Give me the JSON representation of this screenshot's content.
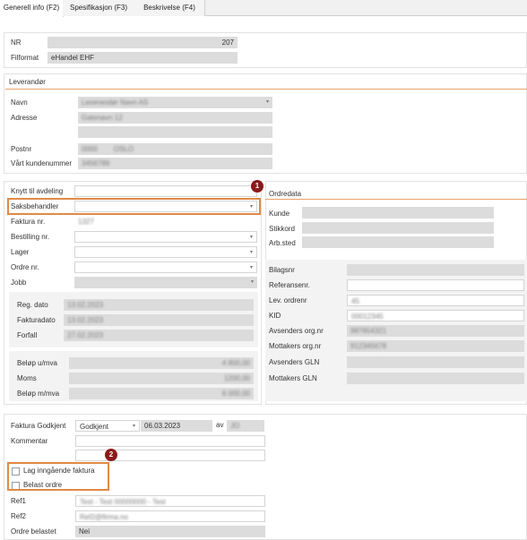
{
  "tabs": [
    {
      "label": "Generell info (F2)"
    },
    {
      "label": "Spesifikasjon (F3)"
    },
    {
      "label": "Beskrivelse (F4)"
    }
  ],
  "general": {
    "nr_label": "NR",
    "nr_value": "207",
    "filformat_label": "Filformat",
    "filformat_value": "eHandel EHF"
  },
  "leverandor": {
    "header": "Leverandør",
    "navn_label": "Navn",
    "navn_value": "Leverandør Navn AS",
    "adresse_label": "Adresse",
    "adresse_value": "Gatenavn 12",
    "postnr_label": "Postnr",
    "postnr_value": "0000",
    "poststed_value": "OSLO",
    "kundenummer_label": "Vårt kundenummer",
    "kundenummer_value": "3456789"
  },
  "left": {
    "knytt_label": "Knytt til avdeling",
    "saksbehandler_label": "Saksbehandler",
    "fakturanr_label": "Faktura nr.",
    "fakturanr_value": "1327",
    "bestilling_label": "Bestilling nr.",
    "lager_label": "Lager",
    "ordre_label": "Ordre nr.",
    "jobb_label": "Jobb",
    "regdato_label": "Reg. dato",
    "regdato_value": "13.02.2023",
    "fakturadato_label": "Fakturadato",
    "fakturadato_value": "13.02.2023",
    "forfall_label": "Forfall",
    "forfall_value": "27.02.2023",
    "belop_label": "Beløp u/mva",
    "belop_value": "4 800,00",
    "moms_label": "Moms",
    "moms_value": "1200,00",
    "belopm_label": "Beløp m/mva",
    "belopm_value": "6 000,00"
  },
  "ordredata": {
    "header": "Ordredata",
    "kunde_label": "Kunde",
    "stikkord_label": "Stikkord",
    "arbsted_label": "Arb.sted",
    "bilagsnr_label": "Bilagsnr",
    "referanse_label": "Referansenr.",
    "levordre_label": "Lev. ordrenr",
    "levordre_value": "45",
    "kid_label": "KID",
    "kid_value": "00012345",
    "avsorg_label": "Avsenders org.nr",
    "avsorg_value": "987654321",
    "mottorg_label": "Mottakers org.nr",
    "mottorg_value": "912345678",
    "avsgln_label": "Avsenders GLN",
    "mottgln_label": "Mottakers GLN"
  },
  "godkjent": {
    "label": "Faktura Godkjent",
    "status": "Godkjent",
    "date": "06.03.2023",
    "av_label": "av",
    "av_value": "JO",
    "kommentar_label": "Kommentar"
  },
  "options": {
    "lag_label": "Lag inngående faktura",
    "belast_label": "Belast ordre"
  },
  "refs": {
    "ref1_label": "Ref1",
    "ref1_value": "Test - Test 00000000 - Test",
    "ref2_label": "Ref2",
    "ref2_value": "Ref2@firma.no",
    "ordrebelastet_label": "Ordre belastet",
    "ordrebelastet_value": "Nei"
  },
  "badges": {
    "one": "1",
    "two": "2"
  },
  "colors": {
    "highlight": "#e08a45",
    "badge": "#8b1a1a",
    "readonly": "#dcdcdc"
  }
}
